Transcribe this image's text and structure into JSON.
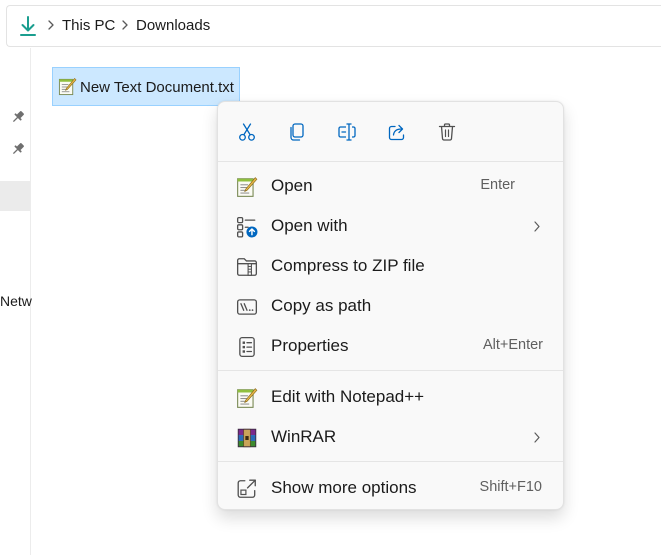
{
  "address_bar": {
    "icon": "download-arrow-icon",
    "crumbs": [
      "This PC",
      "Downloads"
    ]
  },
  "nav": {
    "icons": [
      "pin-icon",
      "pin-icon"
    ],
    "partial_label": "Netw"
  },
  "file": {
    "name": "New Text Document.txt",
    "icon": "notepad-plus-plus-icon",
    "selected": true
  },
  "context_menu": {
    "quick_actions": [
      {
        "name": "Cut",
        "icon": "cut-icon"
      },
      {
        "name": "Copy",
        "icon": "copy-icon"
      },
      {
        "name": "Rename",
        "icon": "rename-icon"
      },
      {
        "name": "Share",
        "icon": "share-icon"
      },
      {
        "name": "Delete",
        "icon": "delete-icon"
      }
    ],
    "items": [
      {
        "label": "Open",
        "shortcut": "Enter",
        "icon": "notepad-plus-plus-icon",
        "submenu": false
      },
      {
        "label": "Open with",
        "shortcut": "",
        "icon": "open-with-icon",
        "submenu": true
      },
      {
        "label": "Compress to ZIP file",
        "shortcut": "",
        "icon": "zip-folder-icon",
        "submenu": false
      },
      {
        "label": "Copy as path",
        "shortcut": "",
        "icon": "copy-path-icon",
        "submenu": false
      },
      {
        "label": "Properties",
        "shortcut": "Alt+Enter",
        "icon": "properties-icon",
        "submenu": false
      }
    ],
    "third_party_items": [
      {
        "label": "Edit with Notepad++",
        "icon": "notepad-plus-plus-icon",
        "submenu": false
      },
      {
        "label": "WinRAR",
        "icon": "winrar-icon",
        "submenu": true
      }
    ],
    "more_options": {
      "label": "Show more options",
      "shortcut": "Shift+F10",
      "icon": "show-more-options-icon"
    }
  },
  "colors": {
    "accent_blue": "#0067c0",
    "teal_download": "#1a9e8f",
    "selection_fill": "#cce8ff",
    "selection_border": "#99d1ff",
    "menu_background": "#f9f9f9"
  }
}
